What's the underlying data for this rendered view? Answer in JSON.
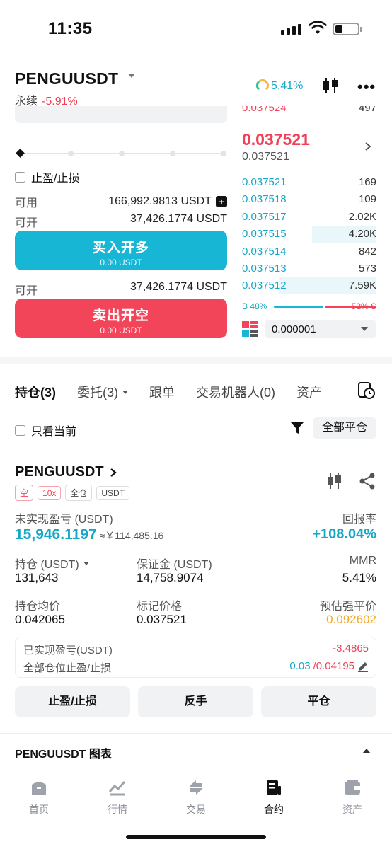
{
  "status": {
    "time": "11:35"
  },
  "header": {
    "symbol": "PENGUUSDT",
    "type": "永续",
    "change": "-5.91%",
    "gauge_pct": "5.41%"
  },
  "order_form": {
    "tpsl_label": "止盈/止损",
    "available_label": "可用",
    "available_value": "166,992.9813 USDT",
    "open_label": "可开",
    "open_long_value": "37,426.1774 USDT",
    "buy_label": "买入开多",
    "buy_sub": "0.00 USDT",
    "open_short_value": "37,426.1774 USDT",
    "sell_label": "卖出开空",
    "sell_sub": "0.00 USDT"
  },
  "orderbook": {
    "top_cut_price": "0.037524",
    "top_cut_qty": "497",
    "last_price": "0.037521",
    "mark_price": "0.037521",
    "bids": [
      {
        "price": "0.037521",
        "qty": "169",
        "depth": 0.0
      },
      {
        "price": "0.037518",
        "qty": "109",
        "depth": 0.0
      },
      {
        "price": "0.037517",
        "qty": "2.02K",
        "depth": 0.0
      },
      {
        "price": "0.037515",
        "qty": "4.20K",
        "depth": 0.48
      },
      {
        "price": "0.037514",
        "qty": "842",
        "depth": 0.0
      },
      {
        "price": "0.037513",
        "qty": "573",
        "depth": 0.0
      },
      {
        "price": "0.037512",
        "qty": "7.59K",
        "depth": 0.72
      }
    ],
    "buy_ratio": "B 48%",
    "sell_ratio": "52% S",
    "buy_ratio_value": 48,
    "precision": "0.000001"
  },
  "tabs": [
    {
      "label": "持仓(3)"
    },
    {
      "label": "委托(3)"
    },
    {
      "label": "跟单"
    },
    {
      "label": "交易机器人(0)"
    },
    {
      "label": "资产"
    }
  ],
  "filter": {
    "only_current": "只看当前",
    "close_all": "全部平仓"
  },
  "position": {
    "symbol": "PENGUUSDT",
    "tags": [
      "空",
      "10x",
      "全仓",
      "USDT"
    ],
    "upnl_label": "未实现盈亏 (USDT)",
    "roi_label": "回报率",
    "upnl": "15,946.1197",
    "upnl_cny": "≈￥114,485.16",
    "roi": "+108.04%",
    "size_label": "持仓 (USDT)",
    "size": "131,643",
    "margin_label": "保证金 (USDT)",
    "margin": "14,758.9074",
    "mmr_label": "MMR",
    "mmr": "5.41%",
    "entry_label": "持仓均价",
    "entry": "0.042065",
    "mark_label": "标记价格",
    "mark": "0.037521",
    "liq_label": "预估强平价",
    "liq": "0.092602",
    "realized_label": "已实现盈亏(USDT)",
    "realized": "-3.4865",
    "tpsl_all_label": "全部仓位止盈/止损",
    "tp": "0.03",
    "sl": "/0.04195",
    "btn_tpsl": "止盈/止损",
    "btn_reverse": "反手",
    "btn_close": "平仓"
  },
  "chart_section": {
    "title": "PENGUUSDT  图表"
  },
  "nav": [
    {
      "label": "首页"
    },
    {
      "label": "行情"
    },
    {
      "label": "交易"
    },
    {
      "label": "合约"
    },
    {
      "label": "资产"
    }
  ],
  "colors": {
    "buy": "#16b6d4",
    "sell": "#f3455a",
    "liq": "#f4a92a"
  }
}
